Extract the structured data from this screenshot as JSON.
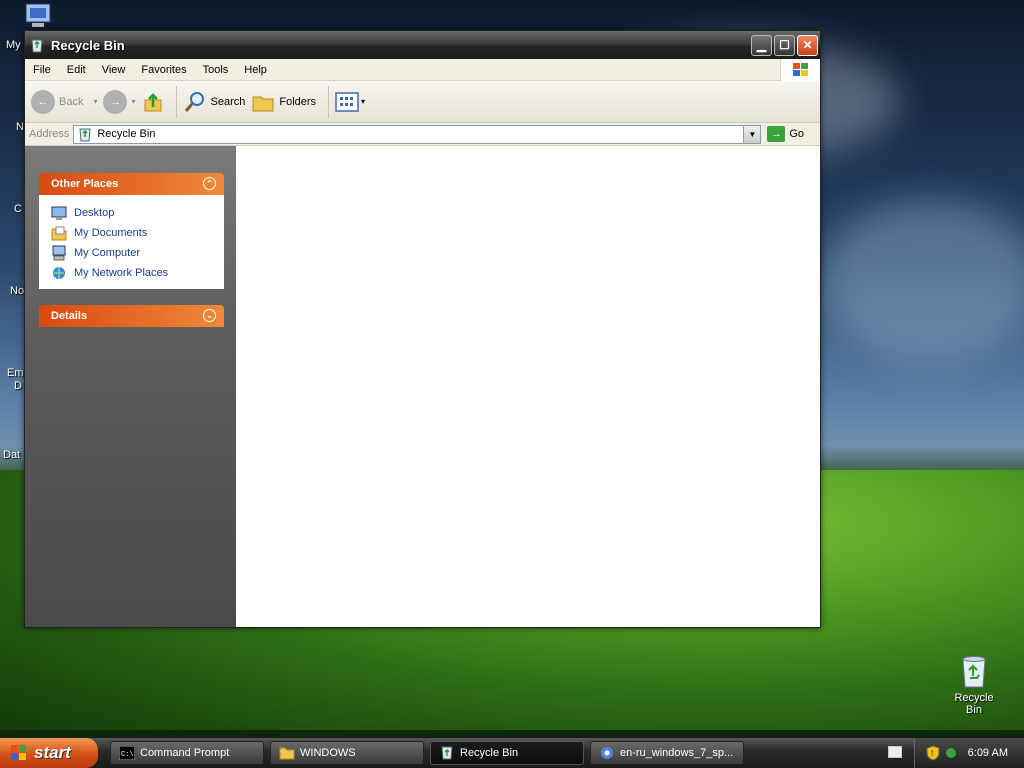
{
  "window": {
    "title": "Recycle Bin"
  },
  "menu": {
    "items": [
      "File",
      "Edit",
      "View",
      "Favorites",
      "Tools",
      "Help"
    ]
  },
  "toolbar": {
    "back": "Back",
    "search": "Search",
    "folders": "Folders"
  },
  "address": {
    "label": "Address",
    "value": "Recycle Bin",
    "go": "Go"
  },
  "left_panel": {
    "other_places": {
      "title": "Other Places",
      "items": [
        "Desktop",
        "My Documents",
        "My Computer",
        "My Network Places"
      ]
    },
    "details": {
      "title": "Details"
    }
  },
  "desktop": {
    "left_labels": [
      "My",
      "N",
      "C",
      "No",
      "Em",
      "D",
      "Dat"
    ],
    "recycle_bin": "Recycle Bin"
  },
  "taskbar": {
    "start": "start",
    "tasks": [
      "Command Prompt",
      "WINDOWS",
      "Recycle Bin",
      "en-ru_windows_7_sp..."
    ],
    "time": "6:09 AM"
  }
}
